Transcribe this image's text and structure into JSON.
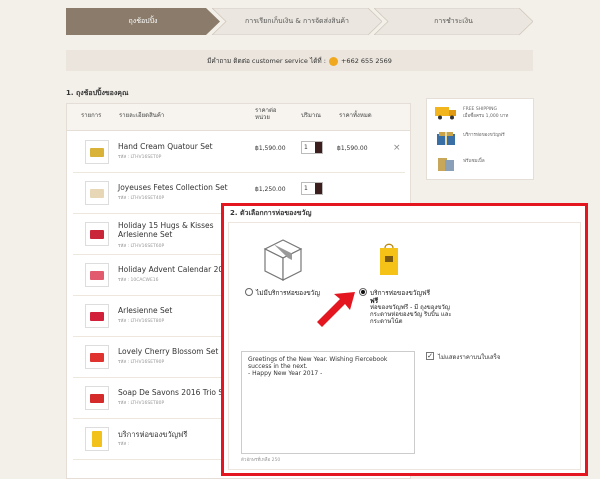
{
  "steps": [
    {
      "label": "ถุงช้อปปิ้ง",
      "state": "active"
    },
    {
      "label": "การเรียกเก็บเงิน & การจัดส่งสินค้า",
      "state": "inactive"
    },
    {
      "label": "การชำระเงิน",
      "state": "inactive"
    }
  ],
  "contact": {
    "prefix": "มีคำถาม ติดต่อ customer service ได้ที่ :",
    "phone": "+662 655 2569",
    "icon": "phone-icon"
  },
  "cart": {
    "title": "1. ถุงช้อปปิ้งของคุณ",
    "headers": {
      "item": "รายการ",
      "detail": "รายละเอียดสินค้า",
      "unit_price_1": "ราคาต่อ",
      "unit_price_2": "หน่วย",
      "qty": "ปริมาณ",
      "total": "ราคาทั้งหมด"
    },
    "items": [
      {
        "name": "Hand Cream Quatour Set",
        "sku": "รหัส : LTHV16SET0P",
        "price": "฿1,590.00",
        "qty": "1",
        "total": "฿1,590.00",
        "color": "#d9b23a"
      },
      {
        "name": "Joyeuses Fetes Collection Set",
        "sku": "รหัส : LTHV16SET40P",
        "price": "฿1,250.00",
        "qty": "1",
        "total": "",
        "color": "#e8d7b7"
      },
      {
        "name": "Holiday 15 Hugs & Kisses Arlesienne Set",
        "sku": "รหัส : LTHV16SET60P",
        "price": "",
        "qty": "",
        "total": "",
        "color": "#c9263a"
      },
      {
        "name": "Holiday Advent Calendar 2016",
        "sku": "รหัส : 10CACWE16",
        "price": "",
        "qty": "",
        "total": "",
        "color": "#e25a6d"
      },
      {
        "name": "Arlesienne Set",
        "sku": "รหัส : LTHV16SET80P",
        "price": "",
        "qty": "",
        "total": "",
        "color": "#d2203a"
      },
      {
        "name": "Lovely Cherry Blossom Set",
        "sku": "รหัส : LTHV16SET90P",
        "price": "",
        "qty": "",
        "total": "",
        "color": "#e0322e"
      },
      {
        "name": "Soap De Savons 2016 Trio Set",
        "sku": "รหัส : LTHV16SET80P",
        "price": "",
        "qty": "",
        "total": "",
        "color": "#d42a2a"
      },
      {
        "name": "บริการห่อของขวัญฟรี",
        "sku": "รหัส :",
        "price": "",
        "qty": "",
        "total": "",
        "color": "#f2c21a"
      }
    ],
    "remove_glyph": "×"
  },
  "side_panel": [
    {
      "icon": "truck-icon",
      "label": "FREE SHIPPING",
      "sub": "เมื่อซื้อครบ 1,000 บาท"
    },
    {
      "icon": "gift-box-icon",
      "label": "บริการห่อของขวัญฟรี",
      "sub": ""
    },
    {
      "icon": "sample-icon",
      "label": "ฟรีแซมเปิ้ล",
      "sub": ""
    }
  ],
  "gift": {
    "title": "2. ตัวเลือกการห่อของขวัญ",
    "option_none": "ไม่มีบริการห่อของขวัญ",
    "option_free": "บริการห่อของขวัญฟรี",
    "option_free_sub": "ฟรี",
    "option_free_desc": "ห่อของขวัญฟรี - มี ถุงของขวัญ กระดาษห่อของขวัญ ริบบิ้น และกระดาษโน้ต",
    "selected": "free",
    "message": "Greetings of the New Year. Wishing Fiercebook success in the next.\n- Happy New Year 2017 -",
    "counter": "ตัวอักษรที่เหลือ 250",
    "hide_price_label": "ไม่แสดงราคาบนใบเสร็จ",
    "hide_price_checked": true,
    "accent": "#e41620"
  },
  "colors": {
    "step_active": "#8a7b6b",
    "step_inactive": "#ebe6df",
    "background": "#f3efe9",
    "overlay_border": "#e41620",
    "qty_dropdown": "#3c1e1e"
  }
}
